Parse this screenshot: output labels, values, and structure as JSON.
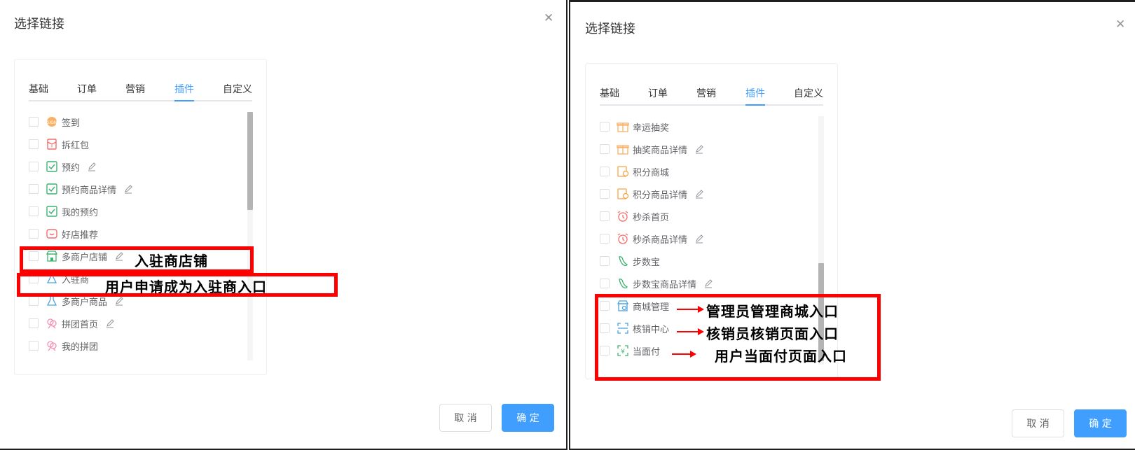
{
  "cancel_label": "取 消",
  "confirm_label": "确 定",
  "left": {
    "title": "选择链接",
    "tabs": [
      "基础",
      "订单",
      "营销",
      "插件",
      "自定义"
    ],
    "items": [
      {
        "label": "签到",
        "icon": "sign-in-icon",
        "editable": false
      },
      {
        "label": "拆红包",
        "icon": "red-packet-icon",
        "editable": false
      },
      {
        "label": "预约",
        "icon": "reserve-icon",
        "editable": true
      },
      {
        "label": "预约商品详情",
        "icon": "reserve-icon",
        "editable": true
      },
      {
        "label": "我的预约",
        "icon": "reserve-icon",
        "editable": false
      },
      {
        "label": "好店推荐",
        "icon": "shop-recommend-icon",
        "editable": false
      },
      {
        "label": "多商户店铺",
        "icon": "store-icon",
        "editable": true
      },
      {
        "label": "入驻商",
        "icon": "merchant-icon",
        "editable": false
      },
      {
        "label": "多商户商品",
        "icon": "merchant-icon",
        "editable": true
      },
      {
        "label": "拼团首页",
        "icon": "group-buy-icon",
        "editable": true
      },
      {
        "label": "我的拼团",
        "icon": "group-buy-icon",
        "editable": false
      }
    ],
    "annotations": [
      "入驻商店铺",
      "用户申请成为入驻商入口"
    ]
  },
  "right": {
    "title": "选择链接",
    "tabs": [
      "基础",
      "订单",
      "营销",
      "插件",
      "自定义"
    ],
    "items": [
      {
        "label": "幸运抽奖",
        "icon": "gift-icon",
        "editable": false
      },
      {
        "label": "抽奖商品详情",
        "icon": "gift-icon",
        "editable": true
      },
      {
        "label": "积分商城",
        "icon": "points-mall-icon",
        "editable": false
      },
      {
        "label": "积分商品详情",
        "icon": "points-mall-icon",
        "editable": true
      },
      {
        "label": "秒杀首页",
        "icon": "alarm-clock-icon",
        "editable": false
      },
      {
        "label": "秒杀商品详情",
        "icon": "alarm-clock-icon",
        "editable": true
      },
      {
        "label": "步数宝",
        "icon": "footprint-icon",
        "editable": false
      },
      {
        "label": "步数宝商品详情",
        "icon": "footprint-icon",
        "editable": true
      },
      {
        "label": "商城管理",
        "icon": "mall-manage-icon",
        "editable": false
      },
      {
        "label": "核销中心",
        "icon": "verify-center-icon",
        "editable": false
      },
      {
        "label": "当面付",
        "icon": "face-pay-icon",
        "editable": false
      }
    ],
    "annotations": [
      "管理员管理商城入口",
      "核销员核销页面入口",
      "用户当面付页面入口"
    ]
  },
  "colors": {
    "accent": "#409eff",
    "highlight": "#ff0000"
  }
}
